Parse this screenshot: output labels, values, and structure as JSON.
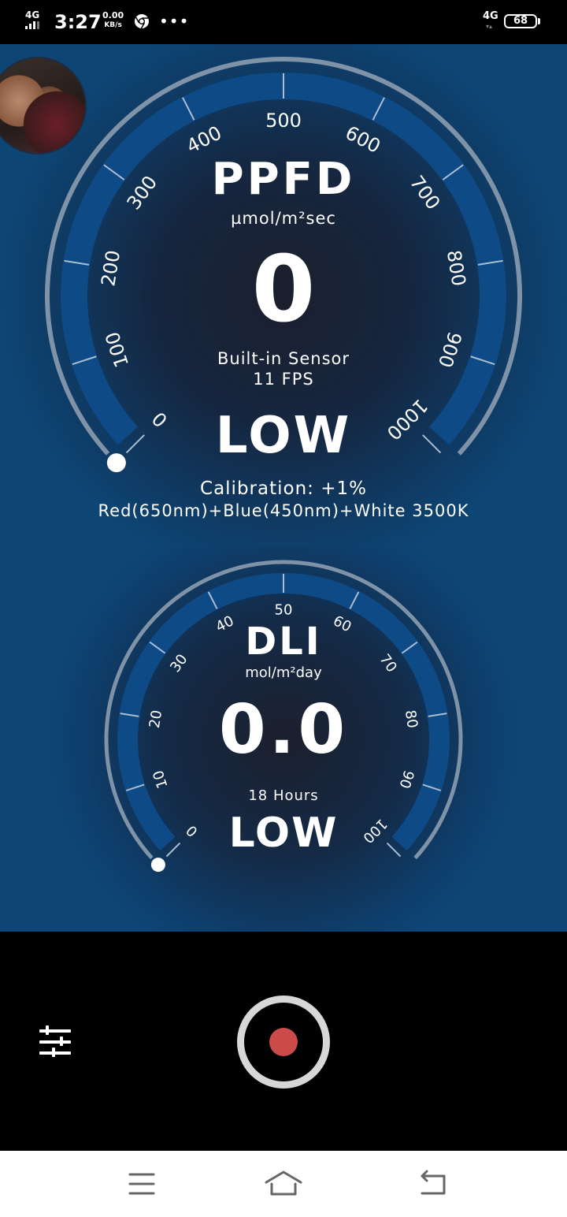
{
  "status_bar": {
    "network": "4G",
    "time": "3:27",
    "speed_value": "0.00",
    "speed_unit": "KB/s",
    "more": "•••",
    "network_right": "4G",
    "network_arrows": "▾▴",
    "battery": "68",
    "icons": [
      "signal-bars-icon",
      "chrome-icon",
      "more-dots-icon",
      "battery-icon"
    ]
  },
  "ppfd": {
    "title": "PPFD",
    "unit": "µmol/m²sec",
    "value": "0",
    "sensor": "Built-in Sensor",
    "fps": "11 FPS",
    "level": "LOW",
    "ticks": [
      "0",
      "100",
      "200",
      "300",
      "400",
      "500",
      "600",
      "700",
      "800",
      "900",
      "1000"
    ],
    "current_fraction": 0
  },
  "calibration": "Calibration: +1%",
  "spectrum": "Red(650nm)+Blue(450nm)+White 3500K",
  "dli": {
    "title": "DLI",
    "unit": "mol/m²day",
    "value": "0.0",
    "hours": "18 Hours",
    "level": "LOW",
    "ticks": [
      "0",
      "10",
      "20",
      "30",
      "40",
      "50",
      "60",
      "70",
      "80",
      "90",
      "100"
    ],
    "current_fraction": 0
  },
  "controls": {
    "settings_icon": "sliders-icon",
    "record_icon": "record-icon",
    "record_color": "#cc4a4a"
  },
  "navbar": {
    "icons": [
      "menu-icon",
      "home-icon",
      "back-icon"
    ]
  },
  "colors": {
    "gauge_band": "#0d4a86",
    "gauge_outer": "#7f93a8",
    "background_deep": "#0d4574"
  }
}
